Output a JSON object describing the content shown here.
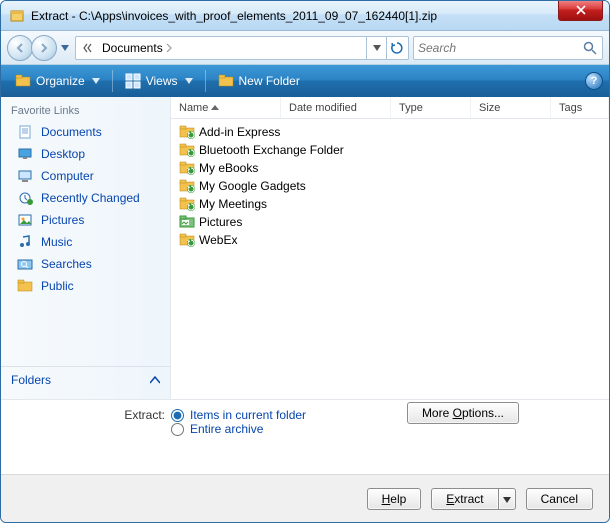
{
  "title": "Extract - C:\\Apps\\invoices_with_proof_elements_2011_09_07_162440[1].zip",
  "breadcrumb": {
    "segment": "Documents"
  },
  "search": {
    "placeholder": "Search"
  },
  "toolbar": {
    "organize": "Organize",
    "views": "Views",
    "newfolder": "New Folder"
  },
  "sidebar": {
    "heading": "Favorite Links",
    "items": [
      {
        "label": "Documents",
        "icon": "documents-icon"
      },
      {
        "label": "Desktop",
        "icon": "desktop-icon"
      },
      {
        "label": "Computer",
        "icon": "computer-icon"
      },
      {
        "label": "Recently Changed",
        "icon": "recent-icon"
      },
      {
        "label": "Pictures",
        "icon": "pictures-icon"
      },
      {
        "label": "Music",
        "icon": "music-icon"
      },
      {
        "label": "Searches",
        "icon": "search-folder-icon"
      },
      {
        "label": "Public",
        "icon": "public-folder-icon"
      }
    ],
    "folders_toggle": "Folders"
  },
  "columns": {
    "name": "Name",
    "date": "Date modified",
    "type": "Type",
    "size": "Size",
    "tags": "Tags"
  },
  "files": [
    {
      "name": "Add-in Express",
      "icon": "folder-sync-icon"
    },
    {
      "name": "Bluetooth Exchange Folder",
      "icon": "folder-sync-icon"
    },
    {
      "name": "My eBooks",
      "icon": "folder-sync-icon"
    },
    {
      "name": "My Google Gadgets",
      "icon": "folder-sync-icon"
    },
    {
      "name": "My Meetings",
      "icon": "folder-sync-icon"
    },
    {
      "name": "Pictures",
      "icon": "pictures-folder-icon"
    },
    {
      "name": "WebEx",
      "icon": "folder-sync-icon"
    }
  ],
  "extract": {
    "label": "Extract:",
    "opt_current": "Items in current folder",
    "opt_archive": "Entire archive",
    "more_options": "More Options..."
  },
  "footer": {
    "help": "Help",
    "extract": "Extract",
    "cancel": "Cancel"
  }
}
